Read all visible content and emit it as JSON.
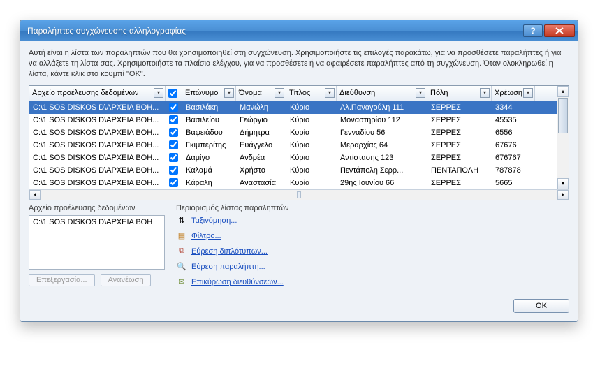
{
  "window": {
    "title": "Παραλήπτες συγχώνευσης αλληλογραφίας"
  },
  "intro": "Αυτή είναι η λίστα των παραληπτών που θα χρησιμοποιηθεί στη συγχώνευση. Χρησιμοποιήστε τις επιλογές παρακάτω, για να προσθέσετε παραλήπτες ή για να αλλάξετε τη λίστα σας. Χρησιμοποιήστε τα πλαίσια ελέγχου, για να προσθέσετε ή να αφαιρέσετε παραλήπτες από τη συγχώνευση. Όταν ολοκληρωθεί η λίστα, κάντε κλικ στο κουμπί \"OK\".",
  "columns": {
    "source": "Αρχείο προέλευσης δεδομένων",
    "lastname": "Επώνυμο",
    "firstname": "Όνομα",
    "title": "Τίτλος",
    "address": "Διεύθυνση",
    "city": "Πόλη",
    "debt": "Χρέωση"
  },
  "rows": [
    {
      "src": "C:\\1 SOS DISKOS D\\ΑΡΧΕΙΑ BOH...",
      "last": "Βασιλάκη",
      "first": "Μανώλη",
      "title": "Κύριο",
      "addr": "Αλ.Παναγούλη 111",
      "city": "ΣΕΡΡΕΣ",
      "debt": "3344"
    },
    {
      "src": "C:\\1 SOS DISKOS D\\ΑΡΧΕΙΑ BOH...",
      "last": "Βασιλείου",
      "first": "Γεώργιο",
      "title": "Κύριο",
      "addr": "Μοναστηρίου 112",
      "city": "ΣΕΡΡΕΣ",
      "debt": "45535"
    },
    {
      "src": "C:\\1 SOS DISKOS D\\ΑΡΧΕΙΑ BOH...",
      "last": "Βαφειάδου",
      "first": "Δήμητρα",
      "title": "Κυρία",
      "addr": "Γενναδίου 56",
      "city": "ΣΕΡΡΕΣ",
      "debt": "6556"
    },
    {
      "src": "C:\\1 SOS DISKOS D\\ΑΡΧΕΙΑ BOH...",
      "last": "Γκιμπερίτης",
      "first": "Ευάγγελο",
      "title": "Κύριο",
      "addr": "Μεραρχίας 64",
      "city": "ΣΕΡΡΕΣ",
      "debt": "67676"
    },
    {
      "src": "C:\\1 SOS DISKOS D\\ΑΡΧΕΙΑ BOH...",
      "last": "Δαμίγο",
      "first": "Ανδρέα",
      "title": "Κύριο",
      "addr": "Αντίστασης 123",
      "city": "ΣΕΡΡΕΣ",
      "debt": "  676767"
    },
    {
      "src": "C:\\1 SOS DISKOS D\\ΑΡΧΕΙΑ BOH...",
      "last": "Καλαμά",
      "first": "Χρήστο",
      "title": "Κύριο",
      "addr": "Πεντάπολη Σερρ...",
      "city": "ΠΕΝΤΑΠΟΛΗ",
      "debt": "787878"
    },
    {
      "src": "C:\\1 SOS DISKOS D\\ΑΡΧΕΙΑ BOH...",
      "last": "Κάραλη",
      "first": "Αναστασία",
      "title": "Κυρία",
      "addr": "29ης Ιουνίου 66",
      "city": "ΣΕΡΡΕΣ",
      "debt": "5665"
    }
  ],
  "lower": {
    "source_label": "Αρχείο προέλευσης δεδομένων",
    "source_entry": "C:\\1 SOS DISKOS D\\ΑΡΧΕΙΑ BOH",
    "edit_btn": "Επεξεργασία...",
    "refresh_btn": "Ανανέωση",
    "filters_label": "Περιορισμός λίστας παραληπτών",
    "sort": "Ταξινόμηση...",
    "filter": "Φίλτρο...",
    "dupes": "Εύρεση διπλότυπων...",
    "find": "Εύρεση παραλήπτη...",
    "validate": "Επικύρωση διευθύνσεων..."
  },
  "ok": "OK"
}
